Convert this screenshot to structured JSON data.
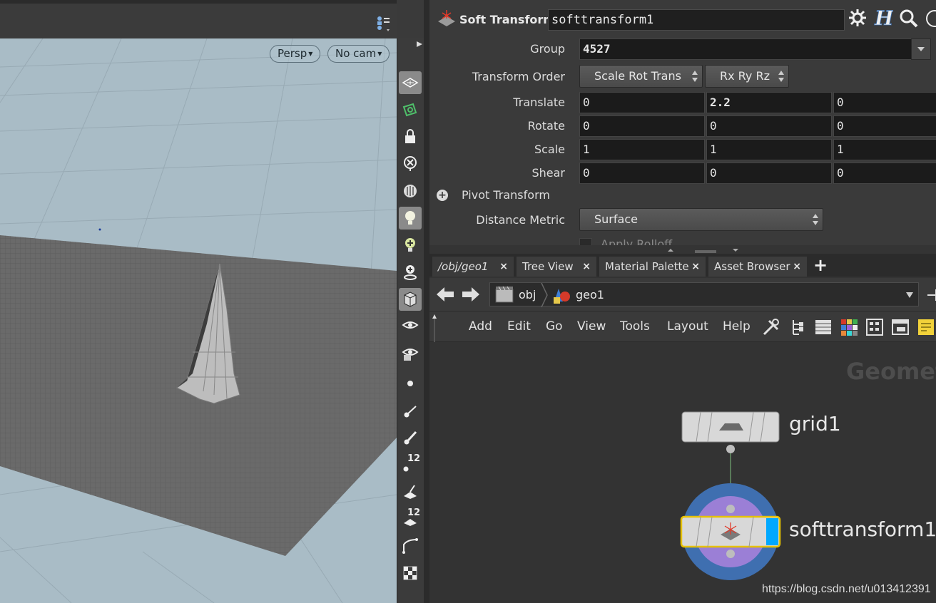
{
  "viewport": {
    "camera_menu": "Persp",
    "cam_menu": "No cam"
  },
  "parameters": {
    "node_type": "Soft Transform",
    "node_name": "softtransform1",
    "group_label": "Group",
    "group_value": "4527",
    "transform_order_label": "Transform Order",
    "transform_order_value": "Scale Rot Trans",
    "rotate_order_value": "Rx Ry Rz",
    "translate_label": "Translate",
    "translate": [
      "0",
      "2.2",
      "0"
    ],
    "rotate_label": "Rotate",
    "rotate": [
      "0",
      "0",
      "0"
    ],
    "scale_label": "Scale",
    "scale": [
      "1",
      "1",
      "1"
    ],
    "shear_label": "Shear",
    "shear": [
      "0",
      "0",
      "0"
    ],
    "pivot_label": "Pivot Transform",
    "distance_metric_label": "Distance Metric",
    "distance_metric_value": "Surface",
    "apply_rolloff_label": "Apply Rolloff"
  },
  "network": {
    "tabs": [
      "/obj/geo1",
      "Tree View",
      "Material Palette",
      "Asset Browser"
    ],
    "path": [
      "obj",
      "geo1"
    ],
    "menus": [
      "Add",
      "Edit",
      "Go",
      "View",
      "Tools",
      "Layout",
      "Help"
    ],
    "context_label": "Geometry",
    "nodes": [
      {
        "name": "grid1"
      },
      {
        "name": "softtransform1"
      }
    ]
  },
  "watermark": "https://blog.csdn.net/u013412391",
  "colors": {
    "viewport_bg": "#a9bcc6",
    "panel_bg": "#3a3a3a",
    "display_flag": "#00a8ff",
    "selected_outline": "#e6c200",
    "template_ring": "#3f6fb0",
    "render_ring": "#9b7fd6"
  }
}
